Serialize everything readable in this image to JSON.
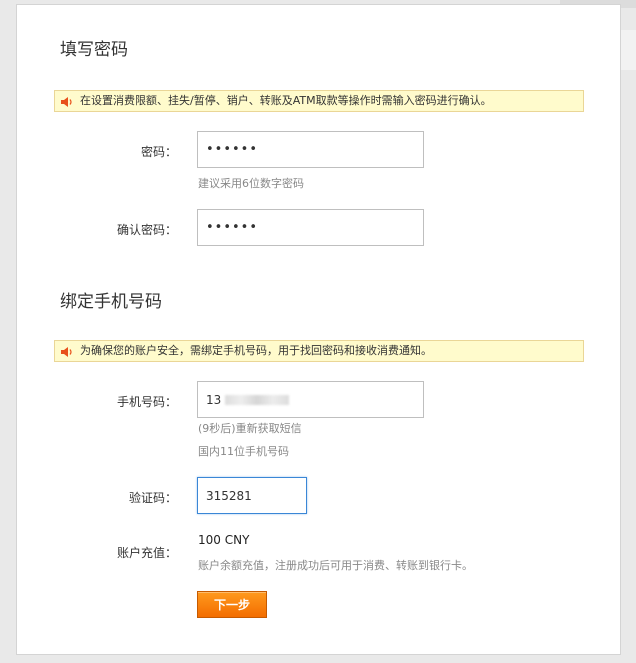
{
  "section1": {
    "title": "填写密码",
    "notice": "在设置消费限额、挂失/暂停、销户、转账及ATM取款等操作时需输入密码进行确认。",
    "password_label": "密码：",
    "password_value": "••••••",
    "password_hint": "建议采用6位数字密码",
    "confirm_label": "确认密码：",
    "confirm_value": "••••••"
  },
  "section2": {
    "title": "绑定手机号码",
    "notice": "为确保您的账户安全，需绑定手机号码，用于找回密码和接收消费通知。",
    "phone_label": "手机号码：",
    "phone_prefix": "13",
    "resend_text": "(9秒后)重新获取短信",
    "phone_hint": "国内11位手机号码",
    "code_label": "验证码：",
    "code_value": "315281",
    "recharge_label": "账户充值：",
    "recharge_amount": "100 CNY",
    "recharge_hint": "账户余额充值，注册成功后可用于消费、转账到银行卡。"
  },
  "next_button": "下一步",
  "colors": {
    "notice_bg": "#fffbcc",
    "button_orange": "#f36d00",
    "focus_border": "#3b87d6"
  },
  "icons": {
    "notice": "speaker-icon"
  }
}
